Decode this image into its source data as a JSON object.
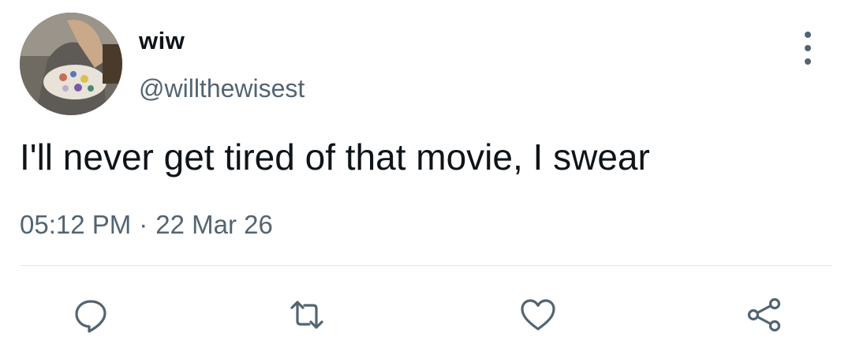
{
  "user": {
    "display_name": "wiw",
    "handle": "@willthewisest",
    "avatar": "avatar-photo"
  },
  "tweet": {
    "text": "I'll never get tired of that movie, I swear",
    "time": "05:12 PM",
    "separator": "·",
    "date": "22 Mar 26"
  },
  "actions": [
    {
      "name": "reply",
      "icon": "reply-icon"
    },
    {
      "name": "retweet",
      "icon": "retweet-icon"
    },
    {
      "name": "like",
      "icon": "heart-icon"
    },
    {
      "name": "share",
      "icon": "share-icon"
    }
  ],
  "colors": {
    "text_primary": "#0f1419",
    "text_secondary": "#536471",
    "divider": "#e1e4e6"
  }
}
